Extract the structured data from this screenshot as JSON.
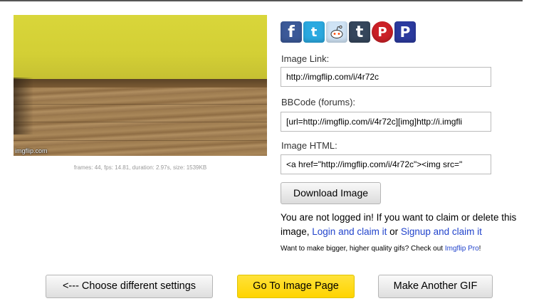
{
  "preview": {
    "watermark": "imgflip.com",
    "gif_info": "frames: 44, fps: 14.81, duration: 2.97s, size: 1539KB"
  },
  "share_icons": [
    {
      "name": "facebook-icon",
      "glyph": "f"
    },
    {
      "name": "twitter-icon",
      "glyph": "t"
    },
    {
      "name": "reddit-icon",
      "glyph": "👽"
    },
    {
      "name": "tumblr-icon",
      "glyph": "t"
    },
    {
      "name": "pinterest-icon",
      "glyph": "P"
    },
    {
      "name": "pinterest-alt-icon",
      "glyph": "P"
    }
  ],
  "fields": {
    "image_link_label": "Image Link:",
    "image_link_value": "http://imgflip.com/i/4r72c",
    "bbcode_label": "BBCode (forums):",
    "bbcode_value": "[url=http://imgflip.com/i/4r72c][img]http://i.imgfli",
    "html_label": "Image HTML:",
    "html_value": "<a href=\"http://imgflip.com/i/4r72c\"><img src=\""
  },
  "download_button": "Download Image",
  "login": {
    "prefix": "You are not logged in! If you want to claim or delete this image, ",
    "login_link": "Login and claim it",
    "or": " or ",
    "signup_link": "Signup and claim it"
  },
  "pro": {
    "text": "Want to make bigger, higher quality gifs? Check out ",
    "link": "Imgflip Pro",
    "suffix": "!"
  },
  "actions": {
    "back": "<--- Choose different settings",
    "goto": "Go To Image Page",
    "another": "Make Another GIF"
  }
}
